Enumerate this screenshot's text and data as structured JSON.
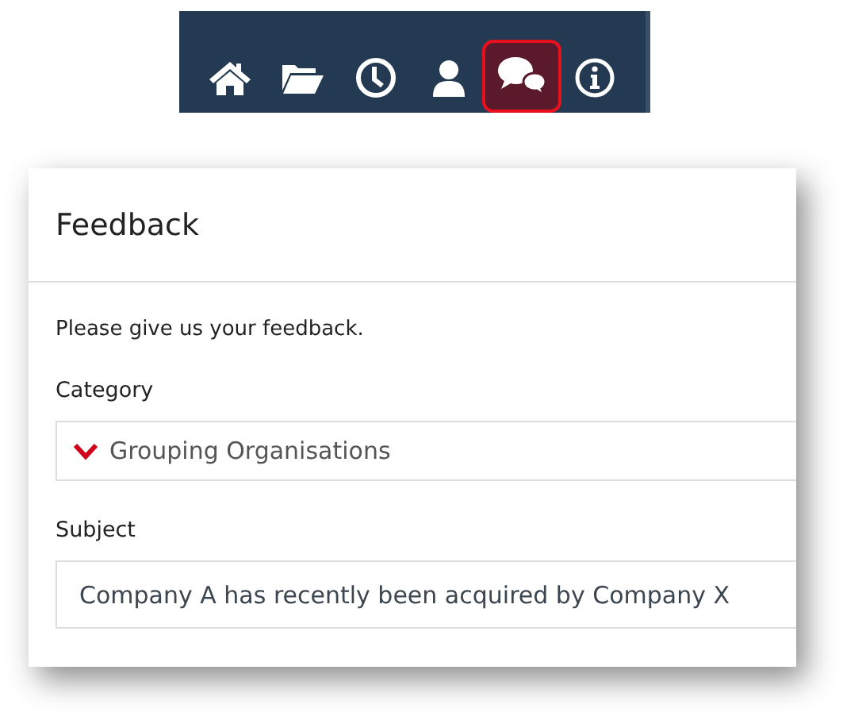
{
  "toolbar": {
    "items": [
      {
        "kind": "home",
        "selected": false
      },
      {
        "kind": "folder",
        "selected": false
      },
      {
        "kind": "clock",
        "selected": false
      },
      {
        "kind": "person",
        "selected": false
      },
      {
        "kind": "chat",
        "selected": true
      },
      {
        "kind": "info",
        "selected": false
      }
    ]
  },
  "dialog": {
    "title": "Feedback",
    "intro": "Please give us your feedback.",
    "category": {
      "label": "Category",
      "value": "Grouping Organisations"
    },
    "subject": {
      "label": "Subject",
      "value": "Company A has recently been acquired by Company X"
    }
  }
}
